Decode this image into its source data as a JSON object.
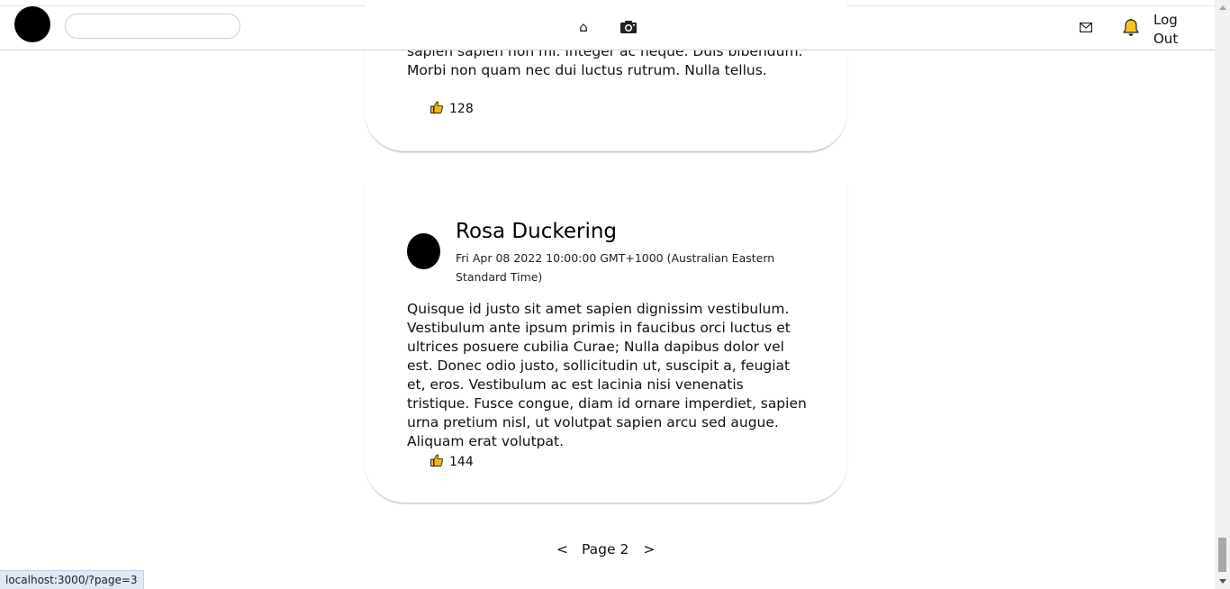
{
  "navbar": {
    "search": {
      "value": "",
      "placeholder": ""
    },
    "icons": [
      "home-icon",
      "camera-icon",
      "mail-icon",
      "bell-icon"
    ],
    "logout_label": "Log Out"
  },
  "posts": [
    {
      "body": "sapien sapien non mi. Integer ac neque. Duis bibendum. Morbi non quam nec dui luctus rutrum. Nulla tellus.",
      "likes": "128"
    },
    {
      "author": "Rosa Duckering",
      "timestamp": "Fri Apr 08 2022 10:00:00 GMT+1000 (Australian Eastern Standard Time)",
      "body": "Quisque id justo sit amet sapien dignissim vestibulum. Vestibulum ante ipsum primis in faucibus orci luctus et ultrices posuere cubilia Curae; Nulla dapibus dolor vel est. Donec odio justo, sollicitudin ut, suscipit a, feugiat et, eros. Vestibulum ac est lacinia nisi venenatis tristique. Fusce congue, diam id ornare imperdiet, sapien urna pretium nisl, ut volutpat sapien arcu sed augue. Aliquam erat volutpat.",
      "likes": "144"
    }
  ],
  "pagination": {
    "prev": "<",
    "label": "Page 2",
    "next": ">"
  },
  "status_bar": {
    "url": "localhost:3000/?page=3"
  },
  "colors": {
    "like_icon": "#f2b705",
    "bell": "#f5c518"
  }
}
